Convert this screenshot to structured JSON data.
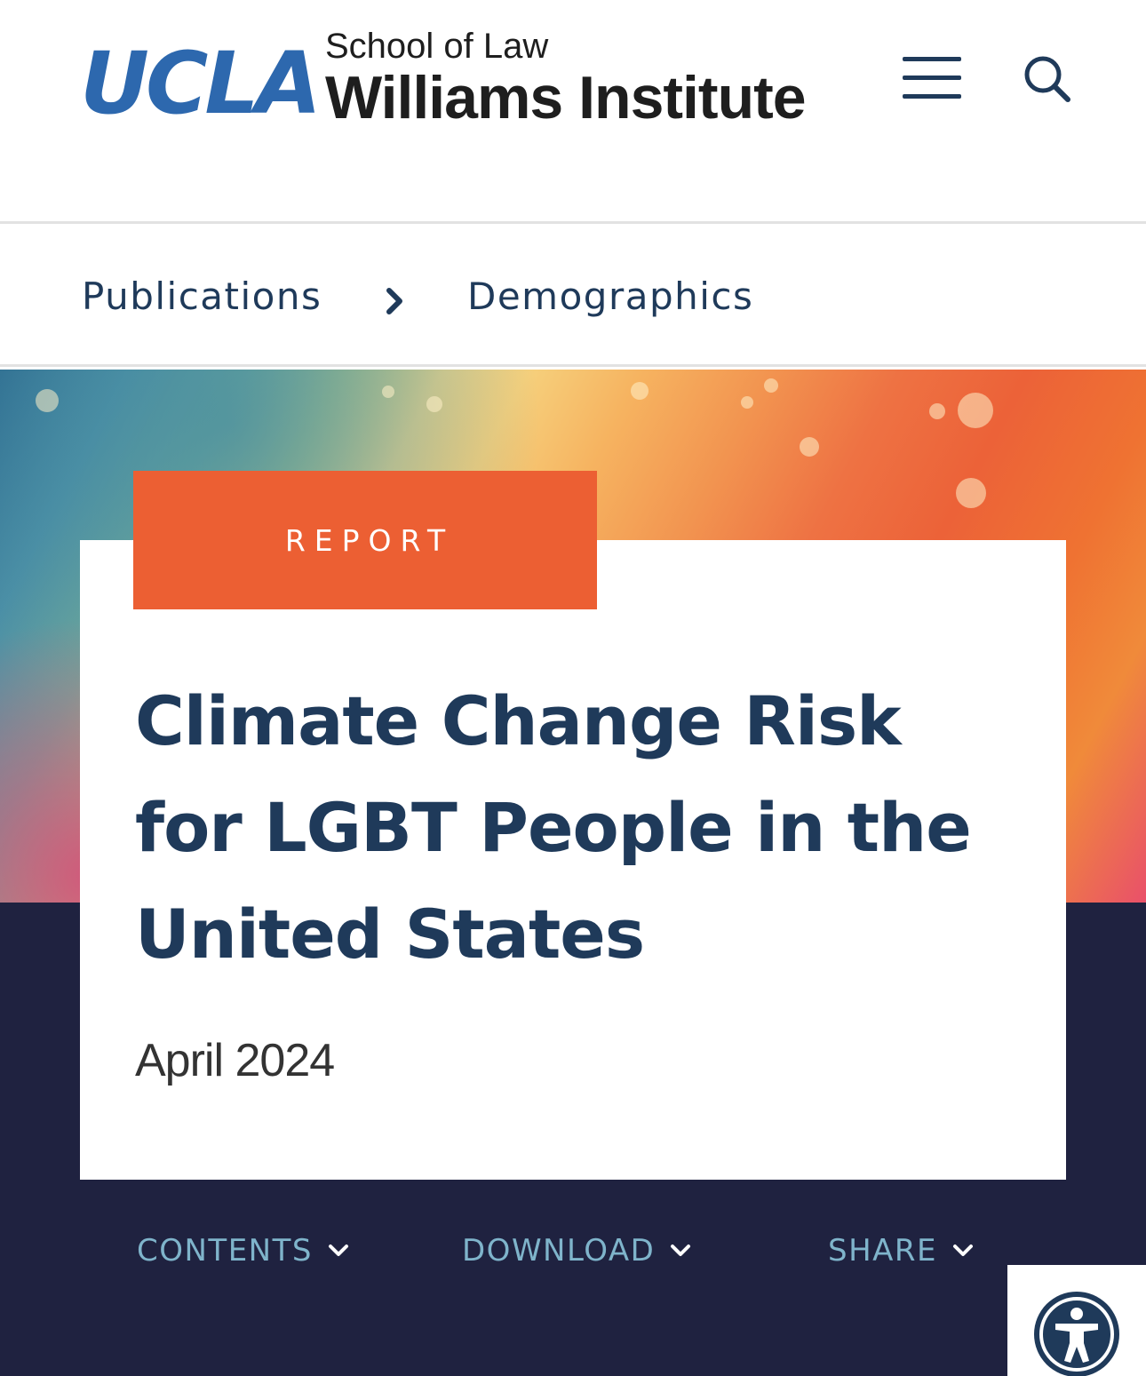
{
  "header": {
    "logo": {
      "ucla": "UCLA",
      "school": "School of Law",
      "institute": "Williams Institute"
    },
    "menu_icon": "hamburger-menu-icon",
    "search_icon": "search-icon"
  },
  "breadcrumb": {
    "items": [
      "Publications",
      "Demographics"
    ],
    "separator_icon": "chevron-right-icon"
  },
  "hero": {
    "tag": "REPORT",
    "title": "Climate Change Risk for LGBT People in the United States",
    "date": "April 2024"
  },
  "actions": [
    {
      "label": "CONTENTS",
      "icon": "chevron-down-icon"
    },
    {
      "label": "DOWNLOAD",
      "icon": "chevron-down-icon"
    },
    {
      "label": "SHARE",
      "icon": "chevron-down-icon"
    }
  ],
  "accessibility": {
    "icon": "accessibility-icon"
  },
  "colors": {
    "brand_blue": "#2d68ae",
    "navy_text": "#1f3a5a",
    "tag_orange": "#ec5f33",
    "dark_band": "#1f2240",
    "action_text": "#7fb4cb"
  }
}
